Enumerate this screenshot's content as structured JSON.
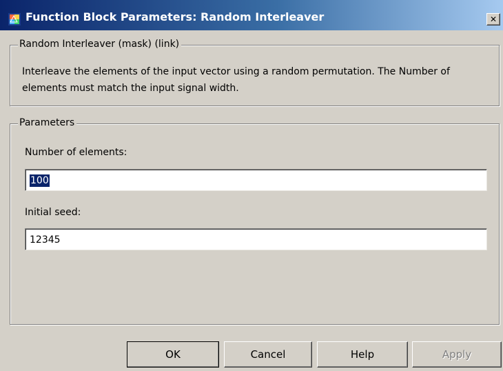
{
  "window": {
    "title": "Function Block Parameters: Random Interleaver",
    "close_symbol": "✕",
    "app_icon": "simulink-block-icon",
    "close_icon": "close-icon"
  },
  "mask_group": {
    "legend": "Random Interleaver (mask) (link)",
    "description": "Interleave the elements of the input vector using a random permutation.  The Number of elements must match the input signal width."
  },
  "parameters_group": {
    "legend": "Parameters",
    "fields": [
      {
        "label": "Number of elements:",
        "value": "100",
        "selected": true
      },
      {
        "label": "Initial seed:",
        "value": "12345",
        "selected": false
      }
    ]
  },
  "buttons": {
    "ok": "OK",
    "cancel": "Cancel",
    "help": "Help",
    "apply": "Apply",
    "apply_enabled": false
  },
  "colors": {
    "titlebar_start": "#0a246a",
    "titlebar_end": "#a6caf0",
    "face": "#d4d0c8",
    "selection": "#0a246a"
  }
}
